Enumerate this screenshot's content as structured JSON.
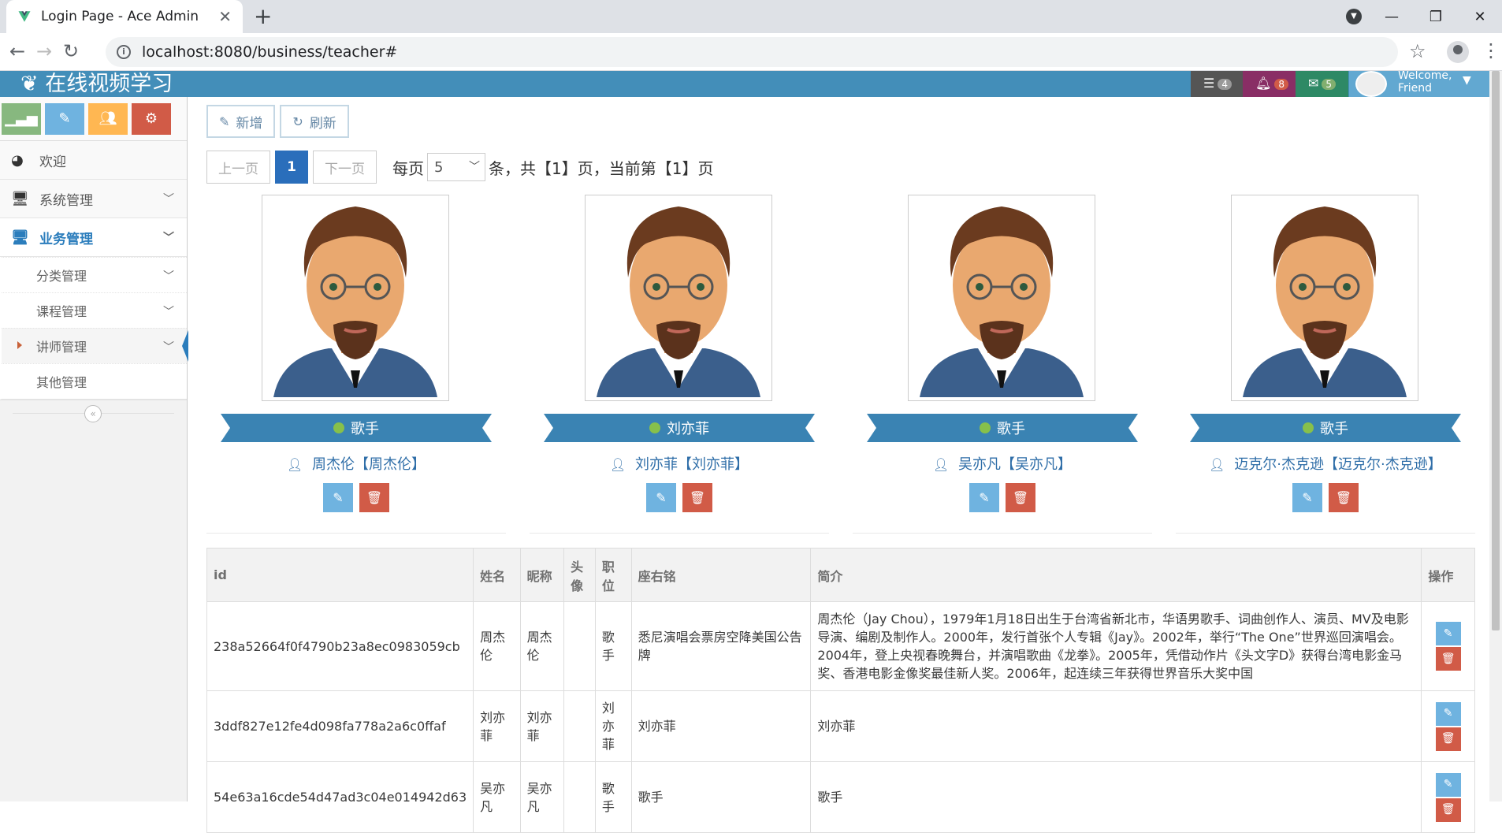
{
  "browser": {
    "tab_title": "Login Page - Ace Admin",
    "url": "localhost:8080/business/teacher#"
  },
  "navbar": {
    "brand": "在线视频学习",
    "badges": {
      "tasks": "4",
      "notifications": "8",
      "messages": "5"
    },
    "welcome_line1": "Welcome,",
    "welcome_line2": "Friend"
  },
  "sidebar": {
    "items": [
      {
        "label": "欢迎"
      },
      {
        "label": "系统管理"
      },
      {
        "label": "业务管理"
      }
    ],
    "submenu": [
      {
        "label": "分类管理"
      },
      {
        "label": "课程管理"
      },
      {
        "label": "讲师管理"
      },
      {
        "label": "其他管理"
      }
    ]
  },
  "toolbar": {
    "add_label": "新增",
    "refresh_label": "刷新"
  },
  "pager": {
    "prev_label": "上一页",
    "current_page": "1",
    "next_label": "下一页",
    "per_page_label": "每页",
    "page_size": "5",
    "summary": "条，共【1】页，当前第【1】页"
  },
  "cards": [
    {
      "position": "歌手",
      "name": "周杰伦【周杰伦】"
    },
    {
      "position": "刘亦菲",
      "name": "刘亦菲【刘亦菲】"
    },
    {
      "position": "歌手",
      "name": "吴亦凡【吴亦凡】"
    },
    {
      "position": "歌手",
      "name": "迈克尔·杰克逊【迈克尔·杰克逊】"
    }
  ],
  "table": {
    "headers": {
      "id": "id",
      "name": "姓名",
      "nickname": "昵称",
      "avatar": "头像",
      "position": "职位",
      "motto": "座右铭",
      "intro": "简介",
      "actions": "操作"
    },
    "rows": [
      {
        "id": "238a52664f0f4790b23a8ec0983059cb",
        "name": "周杰伦",
        "nickname": "周杰伦",
        "position": "歌手",
        "motto": "悉尼演唱会票房空降美国公告牌",
        "intro": "周杰伦（Jay Chou），1979年1月18日出生于台湾省新北市，华语男歌手、词曲创作人、演员、MV及电影导演、编剧及制作人。2000年，发行首张个人专辑《Jay》。2002年，举行“The One”世界巡回演唱会。2004年，登上央视春晚舞台，并演唱歌曲《龙拳》。2005年，凭借动作片《头文字D》获得台湾电影金马奖、香港电影金像奖最佳新人奖。2006年，起连续三年获得世界音乐大奖中国"
      },
      {
        "id": "3ddf827e12fe4d098fa778a2a6c0ffaf",
        "name": "刘亦菲",
        "nickname": "刘亦菲",
        "position": "刘亦菲",
        "motto": "刘亦菲",
        "intro": "刘亦菲"
      },
      {
        "id": "54e63a16cde54d47ad3c04e014942d63",
        "name": "吴亦凡",
        "nickname": "吴亦凡",
        "position": "歌手",
        "motto": "歌手",
        "intro": "歌手"
      }
    ]
  }
}
